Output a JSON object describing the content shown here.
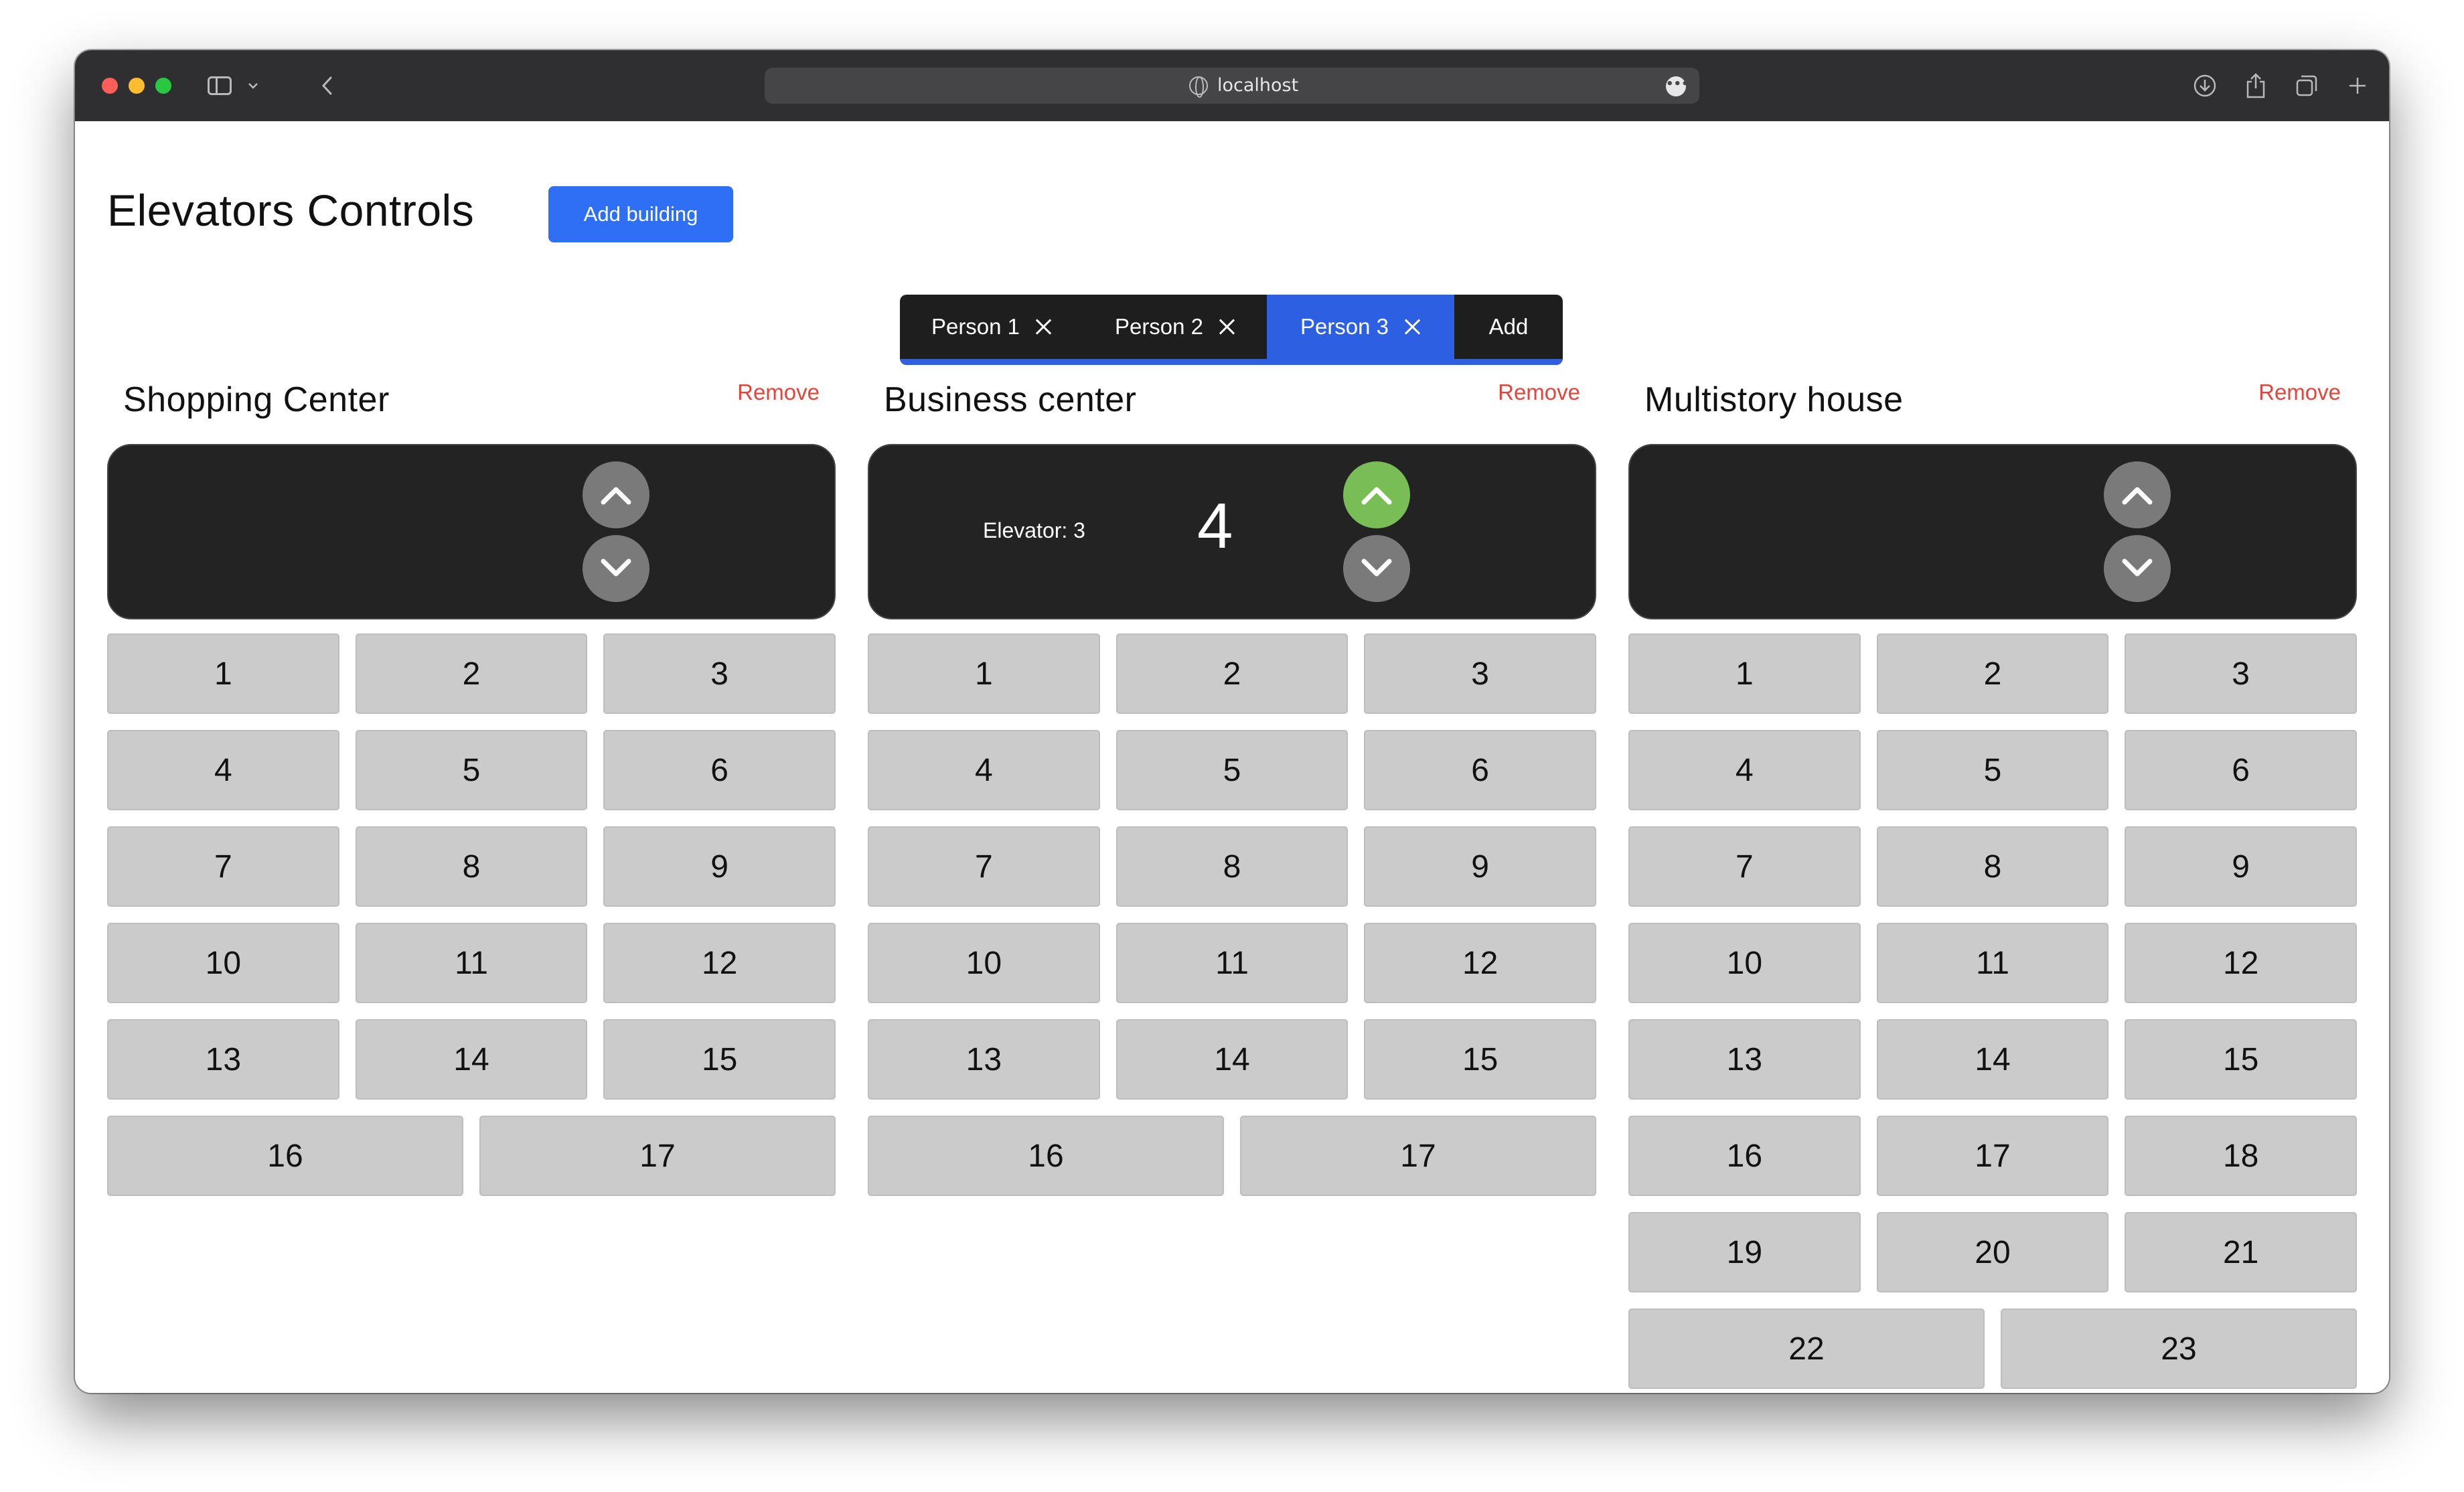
{
  "browser": {
    "address": "localhost"
  },
  "header": {
    "title": "Elevators Controls",
    "add_building_label": "Add building"
  },
  "people_tabs": [
    {
      "label": "Person 1",
      "active": false
    },
    {
      "label": "Person 2",
      "active": false
    },
    {
      "label": "Person 3",
      "active": true
    }
  ],
  "add_person_label": "Add",
  "buildings": [
    {
      "name": "Shopping Center",
      "remove_label": "Remove",
      "elevator_label": "",
      "current_floor": "",
      "up_active": false,
      "floors": [
        "1",
        "2",
        "3",
        "4",
        "5",
        "6",
        "7",
        "8",
        "9",
        "10",
        "11",
        "12",
        "13",
        "14",
        "15",
        "16",
        "17"
      ]
    },
    {
      "name": "Business center",
      "remove_label": "Remove",
      "elevator_label": "Elevator: 3",
      "current_floor": "4",
      "up_active": true,
      "floors": [
        "1",
        "2",
        "3",
        "4",
        "5",
        "6",
        "7",
        "8",
        "9",
        "10",
        "11",
        "12",
        "13",
        "14",
        "15",
        "16",
        "17"
      ]
    },
    {
      "name": "Multistory house",
      "remove_label": "Remove",
      "elevator_label": "",
      "current_floor": "",
      "up_active": false,
      "floors": [
        "1",
        "2",
        "3",
        "4",
        "5",
        "6",
        "7",
        "8",
        "9",
        "10",
        "11",
        "12",
        "13",
        "14",
        "15",
        "16",
        "17",
        "18",
        "19",
        "20",
        "21",
        "22",
        "23"
      ]
    }
  ],
  "colors": {
    "accent": "#2f6ff5",
    "active_tab": "#2d5fe3",
    "remove": "#e3443b",
    "arrow_active": "#79bd55",
    "panel": "#232324",
    "floor_button": "#cbcbcb"
  }
}
